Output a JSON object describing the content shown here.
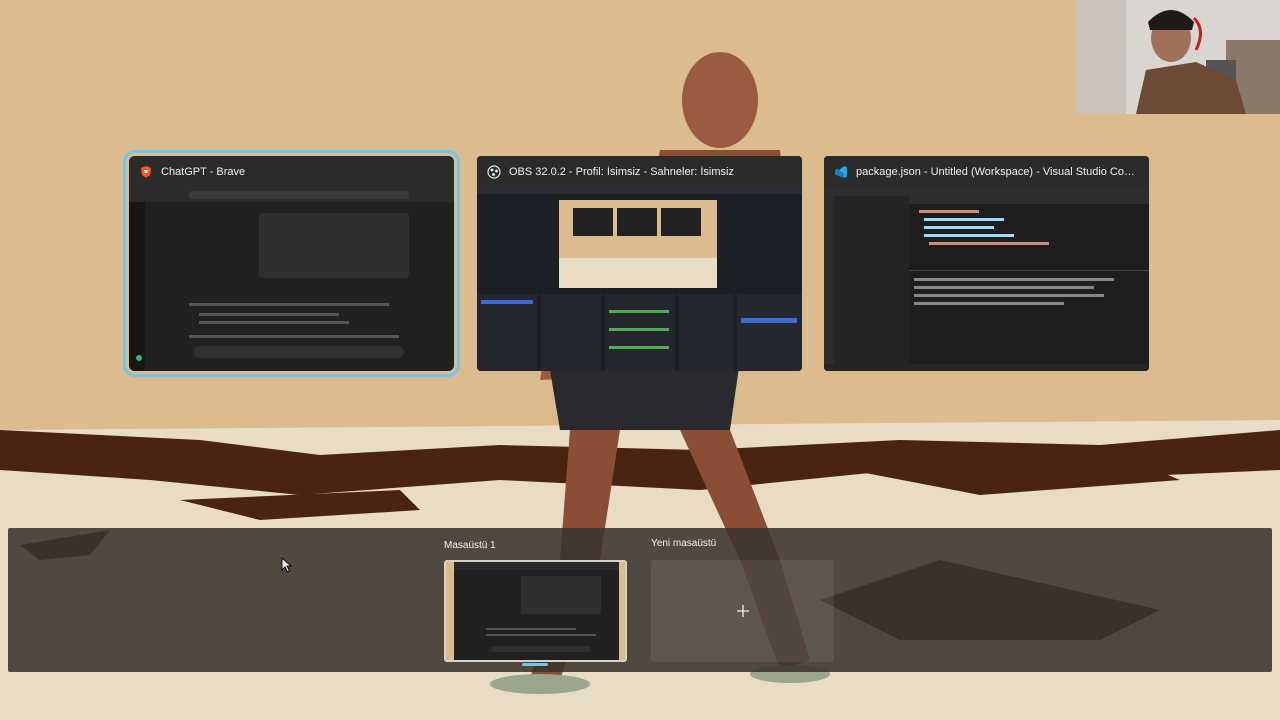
{
  "windows": [
    {
      "title": "ChatGPT - Brave",
      "icon": "brave-icon",
      "active": true
    },
    {
      "title": "OBS 32.0.2 - Profil: İsimsiz - Sahneler: İsimsiz",
      "icon": "obs-icon",
      "active": false
    },
    {
      "title": "package.json - Untitled (Workspace) - Visual Studio Code - In...",
      "icon": "vscode-icon",
      "active": false
    }
  ],
  "desktops": {
    "current_label": "Masaüstü 1",
    "new_label": "Yeni masaüstü"
  },
  "colors": {
    "accent": "#6cc8ee",
    "wallpaper": "#dcbb8f",
    "brave": "#fb542b",
    "vscode": "#23a9f2"
  }
}
